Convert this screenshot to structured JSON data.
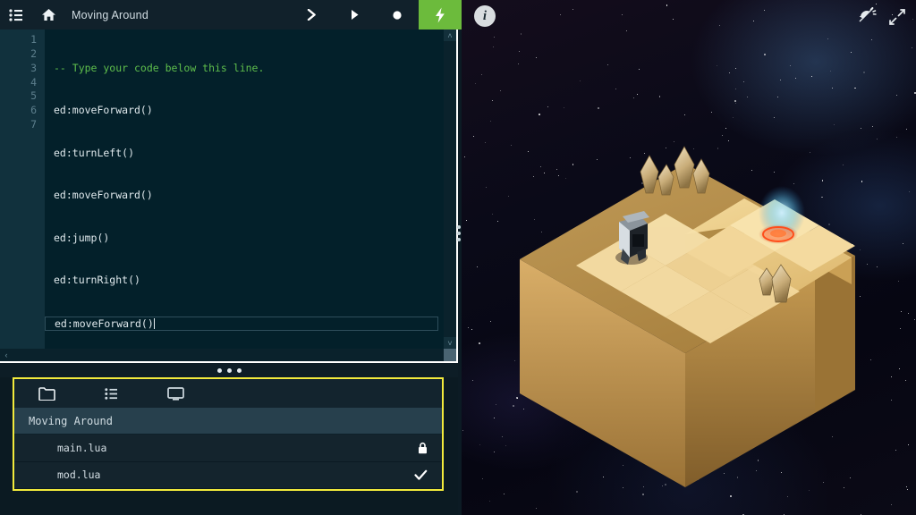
{
  "toolbar": {
    "menu_icon": "list-menu-icon",
    "home_icon": "home-icon",
    "title": "Moving Around",
    "step_label": "❯",
    "play_label": "▶",
    "record_label": "●",
    "run_label": "⚡",
    "run_color": "#6cbb3c"
  },
  "editor": {
    "language": "lua",
    "active_line": 7,
    "lines": [
      {
        "n": "1",
        "text": "-- Type your code below this line.",
        "kind": "comment"
      },
      {
        "n": "2",
        "text": "ed:moveForward()",
        "kind": "code"
      },
      {
        "n": "3",
        "text": "ed:turnLeft()",
        "kind": "code"
      },
      {
        "n": "4",
        "text": "ed:moveForward()",
        "kind": "code"
      },
      {
        "n": "5",
        "text": "ed:jump()",
        "kind": "code"
      },
      {
        "n": "6",
        "text": "ed:turnRight()",
        "kind": "code"
      },
      {
        "n": "7",
        "text": "ed:moveForward()",
        "kind": "code"
      }
    ],
    "comment_color": "#5fbf4c",
    "text_color": "#dfe8ec",
    "background": "#03202a",
    "gutter_background": "#11313d",
    "scroll_left_arrow": "‹",
    "scroll_right_arrow": "›",
    "scroll_up_arrow": "˄",
    "scroll_down_arrow": "˅"
  },
  "splitter": {
    "vertical_handle": "vertical-resize-dots",
    "horizontal_handle": "horizontal-resize-dots"
  },
  "file_panel": {
    "highlight_color": "#f2ea3c",
    "tabs": [
      {
        "name": "tab-files",
        "icon": "folder-icon",
        "selected": true
      },
      {
        "name": "tab-outline",
        "icon": "list-icon",
        "selected": false
      },
      {
        "name": "tab-console",
        "icon": "monitor-icon",
        "selected": false
      }
    ],
    "project_title": "Moving Around",
    "files": [
      {
        "name": "main.lua",
        "marker": "🔒",
        "marker_name": "lock-icon"
      },
      {
        "name": "mod.lua",
        "marker": "✓",
        "marker_name": "check-icon"
      }
    ]
  },
  "game": {
    "info_label": "i",
    "sound_icon": "sound-muted-icon",
    "fullscreen_icon": "fullscreen-expand-icon",
    "scene": "isometric-sand-level",
    "entities": [
      {
        "name": "robot-player",
        "label": ""
      },
      {
        "name": "goal-marker",
        "label": ""
      },
      {
        "name": "crystal-cluster",
        "label": ""
      }
    ]
  }
}
